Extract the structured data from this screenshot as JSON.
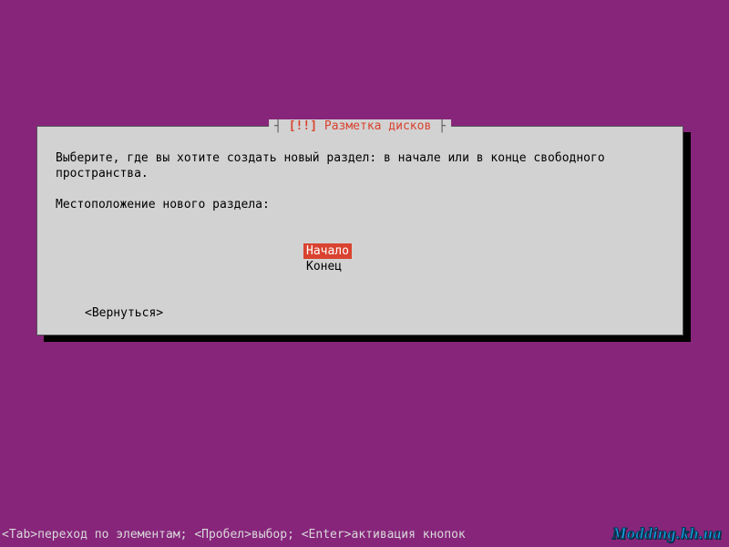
{
  "dialog": {
    "title_prefix": "┤ ",
    "title_bang": "[!!]",
    "title_text": " Разметка дисков",
    "title_suffix": " ├",
    "instruction_line1": "Выберите, где вы хотите создать новый раздел: в начале или в конце свободного",
    "instruction_line2": "пространства.",
    "prompt": "Местоположение нового раздела:",
    "option_begin": "Начало",
    "option_end": "Конец",
    "back": "<Вернуться>"
  },
  "helpbar": "<Tab>переход по элементам; <Пробел>выбор; <Enter>активация кнопок",
  "watermark": "Modding.kh.ua"
}
